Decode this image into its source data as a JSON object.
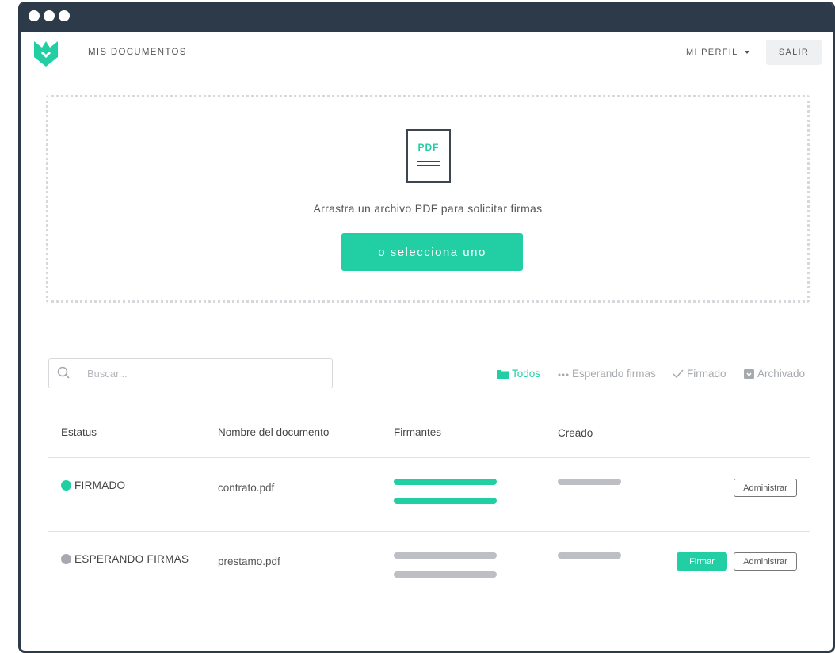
{
  "colors": {
    "accent": "#22cfa4",
    "pending": "#a7a9b0",
    "chrome": "#2d3a4a"
  },
  "header": {
    "nav_title": "MIS DOCUMENTOS",
    "profile_label": "MI PERFIL",
    "logout_label": "SALIR"
  },
  "dropzone": {
    "icon_label": "PDF",
    "text": "Arrastra un archivo PDF para solicitar firmas",
    "button_label": "o selecciona uno"
  },
  "search": {
    "placeholder": "Buscar..."
  },
  "filters": [
    {
      "label": "Todos",
      "icon": "folder-icon",
      "active": true
    },
    {
      "label": "Esperando firmas",
      "icon": "ellipsis-icon",
      "active": false
    },
    {
      "label": "Firmado",
      "icon": "check-icon",
      "active": false
    },
    {
      "label": "Archivado",
      "icon": "archive-icon",
      "active": false
    }
  ],
  "table": {
    "columns": [
      "Estatus",
      "Nombre del documento",
      "Firmantes",
      "Creado"
    ],
    "rows": [
      {
        "status": "FIRMADO",
        "status_color": "#22cfa4",
        "name": "contrato.pdf",
        "signer_bar_color": "#22cfa4",
        "actions": [
          "Administrar"
        ]
      },
      {
        "status": "ESPERANDO FIRMAS",
        "status_color": "#a7a9b0",
        "name": "prestamo.pdf",
        "signer_bar_color": "#bdbfc4",
        "actions": [
          "Firmar",
          "Administrar"
        ]
      }
    ]
  }
}
